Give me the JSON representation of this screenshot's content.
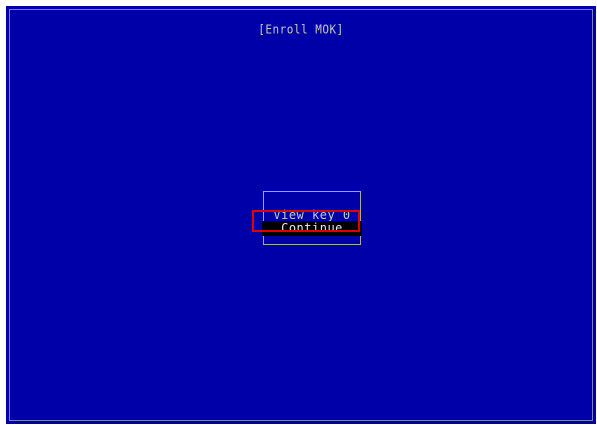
{
  "window": {
    "title": "[Enroll MOK]"
  },
  "menu": {
    "items": [
      {
        "label": "View key 0",
        "selected": false
      },
      {
        "label": "Continue",
        "selected": true
      }
    ]
  },
  "colors": {
    "background": "#0000a8",
    "text": "#c8c8c8",
    "selected_background": "#000000",
    "highlight_outline": "#e00000"
  }
}
